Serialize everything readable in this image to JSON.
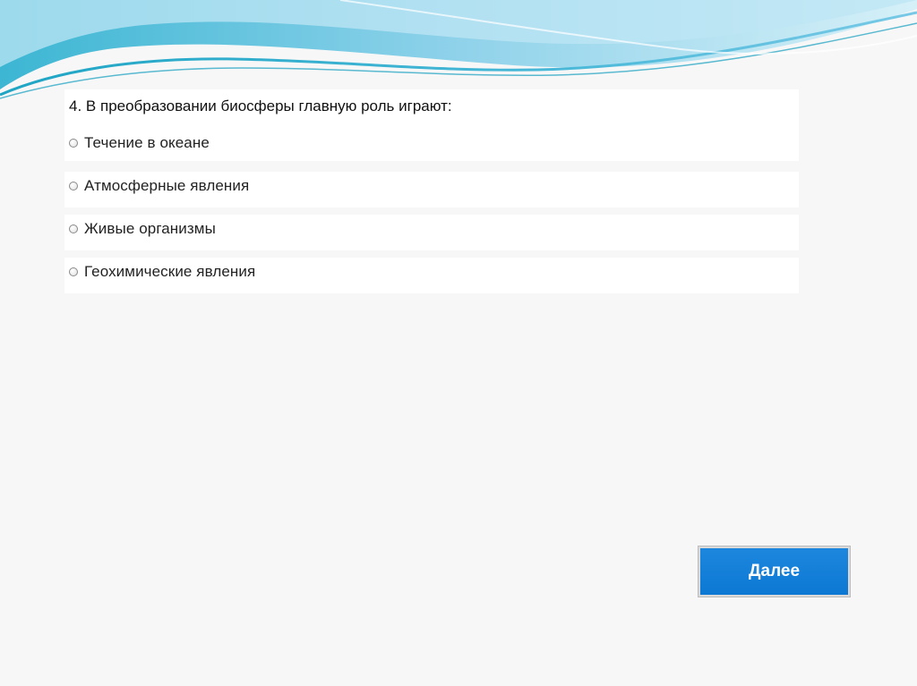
{
  "question": {
    "number": "4.",
    "text": "В преобразовании биосферы главную роль играют:"
  },
  "options": [
    {
      "label": "Течение в океане"
    },
    {
      "label": "Атмосферные явления"
    },
    {
      "label": "Живые организмы"
    },
    {
      "label": "Геохимические явления"
    }
  ],
  "next_button": {
    "label": "Далее"
  },
  "colors": {
    "header_wave_dark": "#2bb2c9",
    "header_wave_light": "#a8dff0",
    "button_blue": "#1581d9",
    "background": "#f7f7f7"
  }
}
